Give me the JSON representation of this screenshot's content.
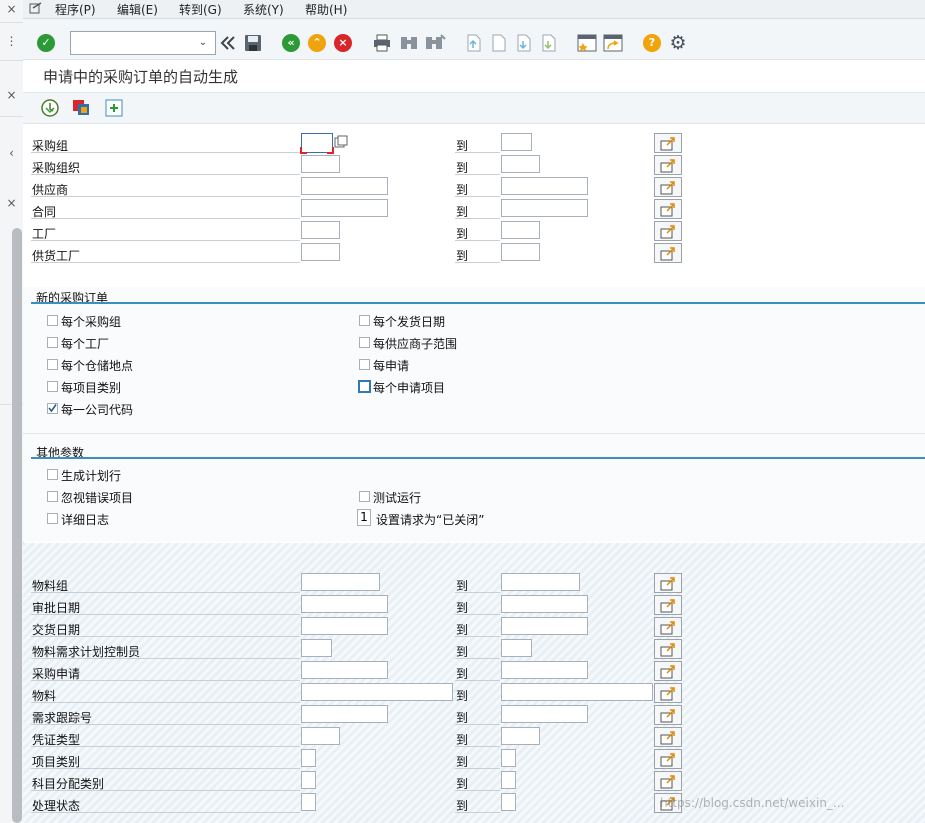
{
  "menu": {
    "items": [
      "程序(P)",
      "编辑(E)",
      "转到(G)",
      "系统(Y)",
      "帮助(H)"
    ]
  },
  "toolbar": {
    "command_value": "",
    "icons": [
      "check-icon",
      "back-nav-icon",
      "save-icon",
      "back-icon",
      "exit-icon",
      "cancel-icon",
      "print-icon",
      "find-icon",
      "find-next-icon",
      "first-page-icon",
      "prev-page-icon",
      "next-page-icon",
      "last-page-icon",
      "create-session-icon",
      "shortcut-icon",
      "help-icon",
      "settings-icon"
    ]
  },
  "title": "申请中的采购订单的自动生成",
  "app_toolbar": {
    "icons": [
      "execute-icon",
      "get-variant-icon",
      "multiple-selection-icon"
    ]
  },
  "to_label": "到",
  "selection_top": [
    {
      "label": "采购组"
    },
    {
      "label": "采购组织"
    },
    {
      "label": "供应商"
    },
    {
      "label": "合同"
    },
    {
      "label": "工厂"
    },
    {
      "label": "供货工厂"
    }
  ],
  "group_new_po": {
    "title": "新的采购订单",
    "left": [
      {
        "label": "每个采购组",
        "checked": false
      },
      {
        "label": "每个工厂",
        "checked": false
      },
      {
        "label": "每个仓储地点",
        "checked": false
      },
      {
        "label": "每项目类别",
        "checked": false
      },
      {
        "label": "每一公司代码",
        "checked": true
      }
    ],
    "right": [
      {
        "label": "每个发货日期",
        "checked": false
      },
      {
        "label": "每供应商子范围",
        "checked": false
      },
      {
        "label": "每申请",
        "checked": false
      },
      {
        "label": "每个申请项目",
        "checked": false
      }
    ]
  },
  "group_other": {
    "title": "其他参数",
    "generate_schedule": "生成计划行",
    "ignore_errors": "忽视错误项目",
    "detailed_log": "详细日志",
    "test_run": "测试运行",
    "set_closed_value": "1",
    "set_closed_label": "设置请求为“已关闭”"
  },
  "selection_bottom": [
    {
      "label": "物料组"
    },
    {
      "label": "审批日期"
    },
    {
      "label": "交货日期"
    },
    {
      "label": "物料需求计划控制员"
    },
    {
      "label": "采购申请"
    },
    {
      "label": "物料"
    },
    {
      "label": "需求跟踪号"
    },
    {
      "label": "凭证类型"
    },
    {
      "label": "项目类别"
    },
    {
      "label": "科目分配类别"
    },
    {
      "label": "处理状态"
    }
  ],
  "watermark": "https://blog.csdn.net/weixin_..."
}
